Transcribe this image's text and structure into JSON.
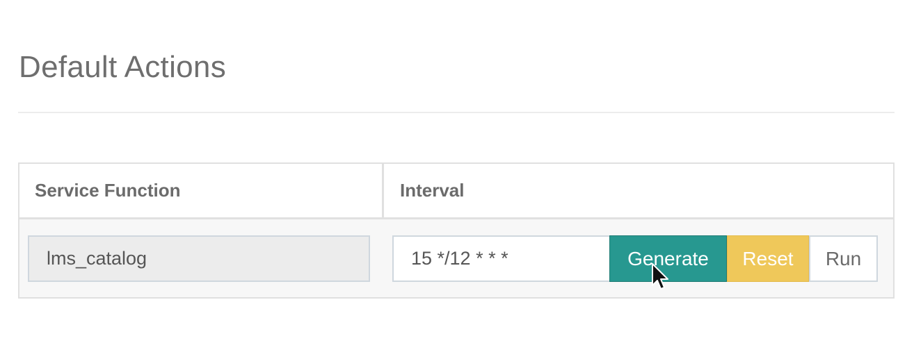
{
  "page": {
    "title": "Default Actions"
  },
  "table": {
    "headers": {
      "service_function": "Service Function",
      "interval": "Interval"
    },
    "rows": [
      {
        "service_function": "lms_catalog",
        "interval": "15 */12 * * *"
      }
    ]
  },
  "buttons": {
    "generate": "Generate",
    "reset": "Reset",
    "run": "Run"
  },
  "colors": {
    "generate_bg": "#279890",
    "reset_bg": "#efc85a",
    "run_bg": "#ffffff",
    "title_text": "#6e6e6e"
  },
  "icons": {
    "cursor": "mouse-pointer-icon"
  }
}
